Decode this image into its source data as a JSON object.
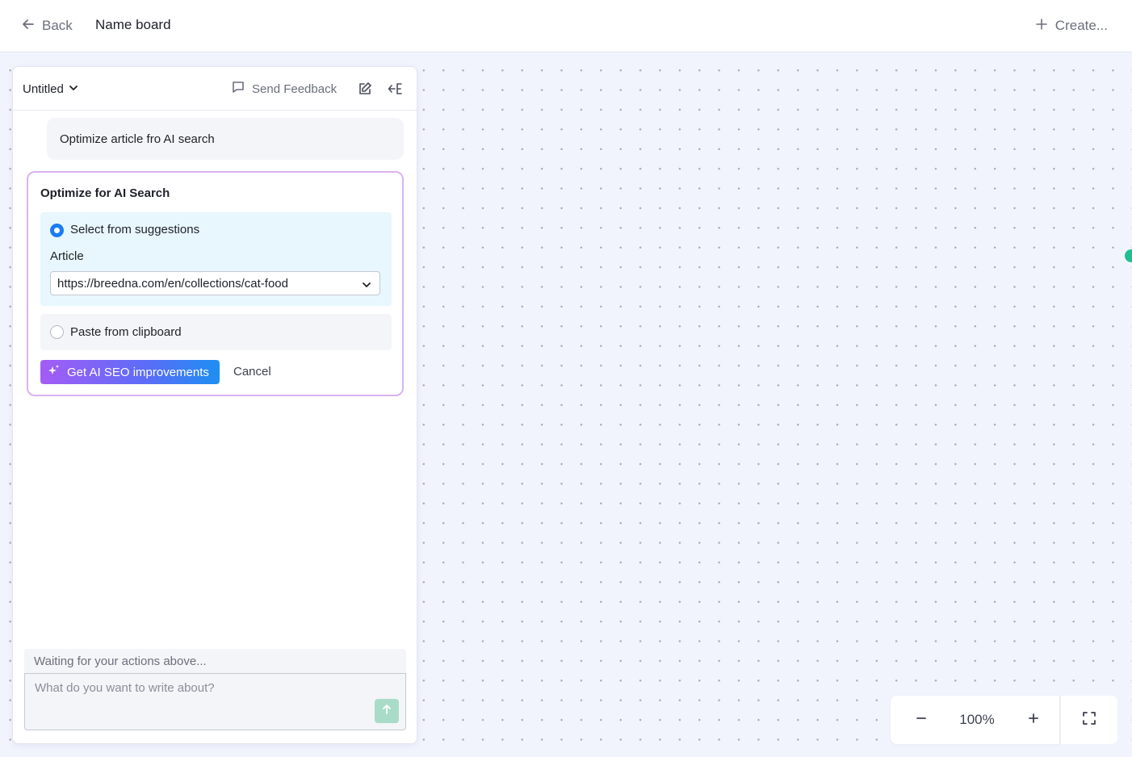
{
  "header": {
    "back_label": "Back",
    "board_title": "Name board",
    "create_label": "Create..."
  },
  "panel": {
    "doc_title": "Untitled",
    "feedback_label": "Send Feedback",
    "user_message": "Optimize article fro AI search",
    "card": {
      "title": "Optimize for AI Search",
      "option_suggestions": "Select from suggestions",
      "article_label": "Article",
      "article_selected": "https://breedna.com/en/collections/cat-food",
      "option_paste": "Paste from clipboard",
      "primary_button": "Get AI SEO improvements",
      "cancel_button": "Cancel",
      "selected_option": "suggestions"
    },
    "status_text": "Waiting for your actions above...",
    "compose_placeholder": "What do you want to write about?"
  },
  "zoom": {
    "level": "100%"
  },
  "colors": {
    "accent_blue": "#1a7cf3",
    "gradient_start": "#a45cf5",
    "gradient_end": "#1d8ff2",
    "send_button": "#a8dcc9",
    "card_border": "#d9b3f0",
    "canvas_bg": "#f1f4fc",
    "status_dot": "#1fbf8f"
  },
  "icons": {
    "back": "arrow-left-icon",
    "create": "plus-icon",
    "doc_dropdown": "chevron-down-icon",
    "feedback": "message-square-icon",
    "edit": "edit-icon",
    "collapse": "collapse-panel-icon",
    "sparkle": "sparkle-icon",
    "send": "arrow-up-icon",
    "zoom_out": "minus-icon",
    "zoom_in": "plus-icon",
    "fullscreen": "fullscreen-icon"
  }
}
